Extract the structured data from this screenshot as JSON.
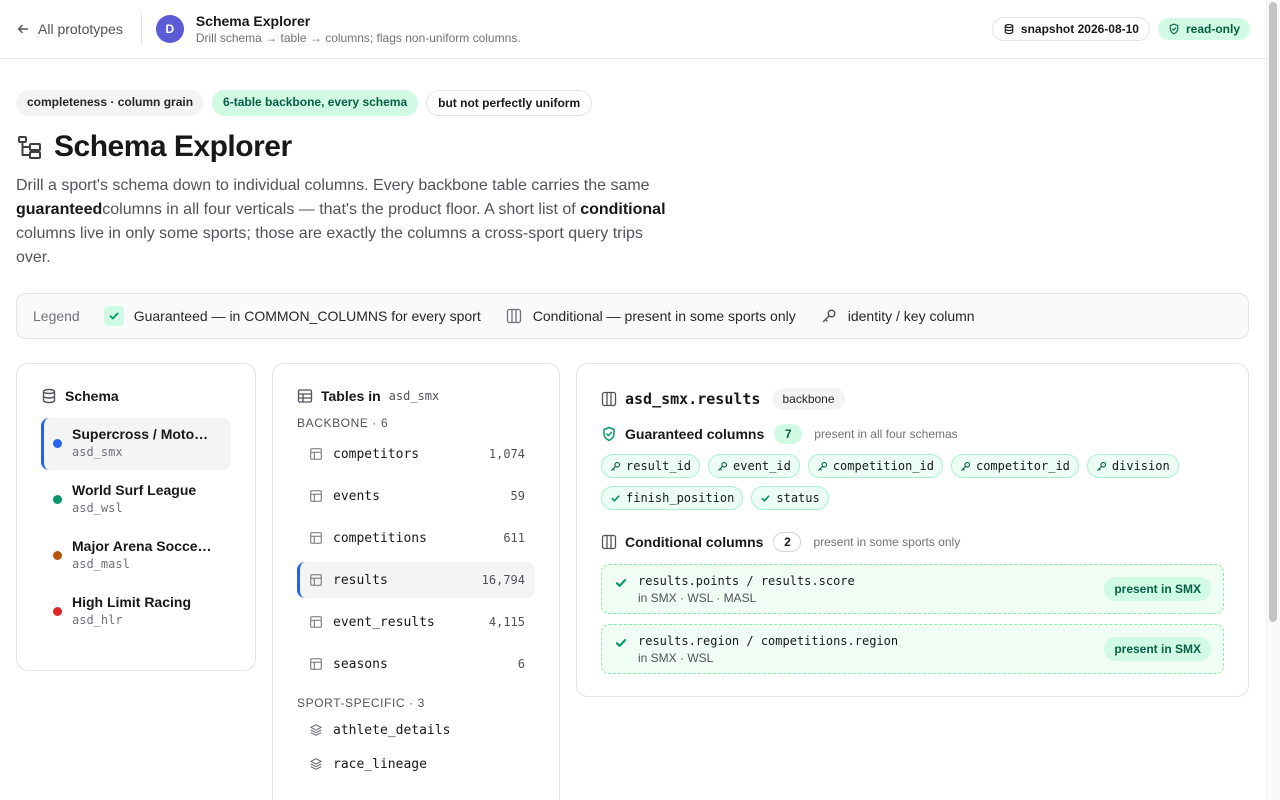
{
  "header": {
    "back_label": "All prototypes",
    "avatar_letter": "D",
    "title": "Schema Explorer",
    "subtitle": "Drill schema → table → columns; flags non-uniform columns.",
    "snapshot_label": "snapshot 2026-08-10",
    "readonly_label": "read-only"
  },
  "tags": [
    "completeness · column grain",
    "6-table backbone, every schema",
    "but not perfectly uniform"
  ],
  "page": {
    "title": "Schema Explorer",
    "desc_1": "Drill a sport's schema down to individual columns. Every backbone table carries the same ",
    "desc_b1": "guaranteed",
    "desc_2": "columns in all four verticals — that's the product floor. A short list of ",
    "desc_b2": "conditional",
    "desc_3": " columns live in only some sports; those are exactly the columns a cross-sport query trips over."
  },
  "legend": {
    "label": "Legend",
    "guaranteed": "Guaranteed — in COMMON_COLUMNS for every sport",
    "conditional": "Conditional — present in some sports only",
    "identity": "identity / key column"
  },
  "schema_panel": {
    "title": "Schema",
    "items": [
      {
        "name": "Supercross / Motocross",
        "code": "asd_smx",
        "color": "#2563eb"
      },
      {
        "name": "World Surf League",
        "code": "asd_wsl",
        "color": "#059669"
      },
      {
        "name": "Major Arena Soccer League",
        "code": "asd_masl",
        "color": "#b45309"
      },
      {
        "name": "High Limit Racing",
        "code": "asd_hlr",
        "color": "#dc2626"
      }
    ]
  },
  "tables_panel": {
    "title": "Tables in",
    "schema_code": "asd_smx",
    "backbone_label": "BACKBONE · 6",
    "backbone": [
      {
        "name": "competitors",
        "count": "1,074"
      },
      {
        "name": "events",
        "count": "59"
      },
      {
        "name": "competitions",
        "count": "611"
      },
      {
        "name": "results",
        "count": "16,794"
      },
      {
        "name": "event_results",
        "count": "4,115"
      },
      {
        "name": "seasons",
        "count": "6"
      }
    ],
    "specific_label": "SPORT-SPECIFIC · 3",
    "specific": [
      {
        "name": "athlete_details"
      },
      {
        "name": "race_lineage"
      }
    ]
  },
  "detail": {
    "table_name": "asd_smx.results",
    "badge": "backbone",
    "guaranteed_title": "Guaranteed columns",
    "guaranteed_count": "7",
    "guaranteed_sub": "present in all four schemas",
    "guaranteed_cols": [
      {
        "name": "result_id",
        "icon": "key-icon"
      },
      {
        "name": "event_id",
        "icon": "key-icon"
      },
      {
        "name": "competition_id",
        "icon": "key-icon"
      },
      {
        "name": "competitor_id",
        "icon": "key-icon"
      },
      {
        "name": "division",
        "icon": "key-icon"
      },
      {
        "name": "finish_position",
        "icon": "check-icon"
      },
      {
        "name": "status",
        "icon": "check-icon"
      }
    ],
    "conditional_title": "Conditional columns",
    "conditional_count": "2",
    "conditional_sub": "present in some sports only",
    "conditional_cols": [
      {
        "name": "results.points / results.score",
        "sports": "in SMX · WSL · MASL",
        "badge": "present in SMX"
      },
      {
        "name": "results.region / competitions.region",
        "sports": "in SMX · WSL",
        "badge": "present in SMX"
      }
    ]
  }
}
